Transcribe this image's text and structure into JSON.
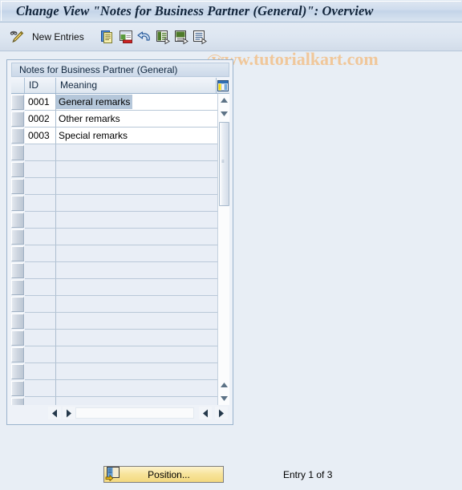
{
  "window": {
    "title": "Change View \"Notes for Business Partner (General)\": Overview"
  },
  "watermark": {
    "text": "www.tutorialkart.com",
    "color": "#f0c79a"
  },
  "toolbar": {
    "display_change_icon": "pencil-display-change-icon",
    "new_entries_label": "New Entries",
    "buttons": [
      {
        "name": "copy-as-icon",
        "label": "Copy As..."
      },
      {
        "name": "delete-icon",
        "label": "Delete"
      },
      {
        "name": "undo-icon",
        "label": "Undo Change"
      },
      {
        "name": "select-all-icon",
        "label": "Select All"
      },
      {
        "name": "select-block-icon",
        "label": "Select Block"
      },
      {
        "name": "deselect-all-icon",
        "label": "Deselect All"
      }
    ]
  },
  "panel": {
    "title": "Notes for Business Partner (General)",
    "grid_config_icon": "table-settings-icon",
    "columns": [
      {
        "key": "select",
        "label": ""
      },
      {
        "key": "id",
        "label": "ID"
      },
      {
        "key": "meaning",
        "label": "Meaning"
      }
    ],
    "rows": [
      {
        "id": "0001",
        "meaning": "General remarks",
        "selected": true
      },
      {
        "id": "0002",
        "meaning": "Other remarks",
        "selected": false
      },
      {
        "id": "0003",
        "meaning": "Special remarks",
        "selected": false
      }
    ],
    "empty_row_count": 16,
    "vertical_scrollbar": {
      "up_icon": "scroll-up-icon",
      "down_icon": "scroll-down-icon",
      "page_up_icon": "page-up-icon",
      "page_down_icon": "page-down-icon"
    },
    "horizontal_scrollbar": {
      "left_icon": "scroll-left-icon",
      "right_icon": "scroll-right-icon",
      "left_icon_2": "scroll-left-icon",
      "right_icon_2": "scroll-right-icon"
    }
  },
  "footer": {
    "position_button_label": "Position...",
    "position_button_icon": "position-icon",
    "entry_status": "Entry 1 of 3"
  },
  "colors": {
    "background": "#e8eef5",
    "title_text": "#11243a",
    "selection_highlight": "#b5c7da",
    "button_yellow": "#f7e39a"
  }
}
